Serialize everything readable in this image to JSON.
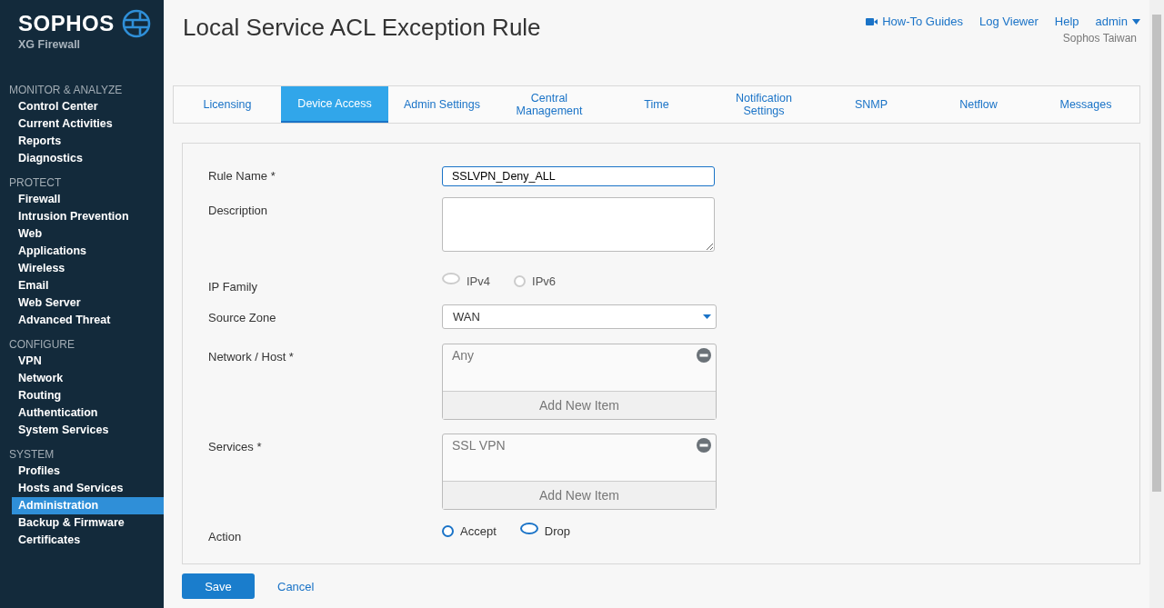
{
  "sidebar": {
    "brand": "SOPHOS",
    "product": "XG Firewall",
    "sections": [
      {
        "heading": "MONITOR & ANALYZE",
        "items": [
          {
            "label": "Control Center",
            "selected": false
          },
          {
            "label": "Current Activities",
            "selected": false
          },
          {
            "label": "Reports",
            "selected": false
          },
          {
            "label": "Diagnostics",
            "selected": false
          }
        ]
      },
      {
        "heading": "PROTECT",
        "items": [
          {
            "label": "Firewall",
            "selected": false
          },
          {
            "label": "Intrusion Prevention",
            "selected": false
          },
          {
            "label": "Web",
            "selected": false
          },
          {
            "label": "Applications",
            "selected": false
          },
          {
            "label": "Wireless",
            "selected": false
          },
          {
            "label": "Email",
            "selected": false
          },
          {
            "label": "Web Server",
            "selected": false
          },
          {
            "label": "Advanced Threat",
            "selected": false
          }
        ]
      },
      {
        "heading": "CONFIGURE",
        "items": [
          {
            "label": "VPN",
            "selected": false
          },
          {
            "label": "Network",
            "selected": false
          },
          {
            "label": "Routing",
            "selected": false
          },
          {
            "label": "Authentication",
            "selected": false
          },
          {
            "label": "System Services",
            "selected": false
          }
        ]
      },
      {
        "heading": "SYSTEM",
        "items": [
          {
            "label": "Profiles",
            "selected": false
          },
          {
            "label": "Hosts and Services",
            "selected": false
          },
          {
            "label": "Administration",
            "selected": true
          },
          {
            "label": "Backup & Firmware",
            "selected": false
          },
          {
            "label": "Certificates",
            "selected": false
          }
        ]
      }
    ]
  },
  "header": {
    "title": "Local Service ACL Exception Rule",
    "links": [
      {
        "label": "How-To Guides",
        "kind": "video"
      },
      {
        "label": "Log Viewer",
        "kind": "plain"
      },
      {
        "label": "Help",
        "kind": "plain"
      },
      {
        "label": "admin",
        "kind": "menu"
      }
    ],
    "organization": "Sophos Taiwan"
  },
  "tabs": [
    {
      "label": "Licensing",
      "selected": false
    },
    {
      "label": "Device Access",
      "selected": true
    },
    {
      "label": "Admin Settings",
      "selected": false
    },
    {
      "label": "Central Management",
      "selected": false
    },
    {
      "label": "Time",
      "selected": false
    },
    {
      "label": "Notification Settings",
      "selected": false
    },
    {
      "label": "SNMP",
      "selected": false
    },
    {
      "label": "Netflow",
      "selected": false
    },
    {
      "label": "Messages",
      "selected": false
    }
  ],
  "form": [
    {
      "kind": "text",
      "label": "Rule Name *",
      "value": "SSLVPN_Deny_ALL"
    },
    {
      "kind": "textarea",
      "label": "Description"
    },
    {
      "kind": "radio",
      "label": "IP Family",
      "disabled": true,
      "options": [
        {
          "label": "IPv4",
          "selected": true
        },
        {
          "label": "IPv6",
          "selected": false
        }
      ]
    },
    {
      "kind": "select",
      "label": "Source Zone",
      "value": "WAN"
    },
    {
      "kind": "list",
      "label": "Network / Host *",
      "items": [
        "Any"
      ],
      "add": "Add New Item"
    },
    {
      "kind": "list",
      "label": "Services *",
      "items": [
        "SSL VPN"
      ],
      "add": "Add New Item"
    },
    {
      "kind": "radio",
      "label": "Action",
      "disabled": false,
      "options": [
        {
          "label": "Accept",
          "selected": false
        },
        {
          "label": "Drop",
          "selected": true
        }
      ]
    }
  ],
  "buttons": {
    "save": "Save",
    "cancel": "Cancel"
  }
}
